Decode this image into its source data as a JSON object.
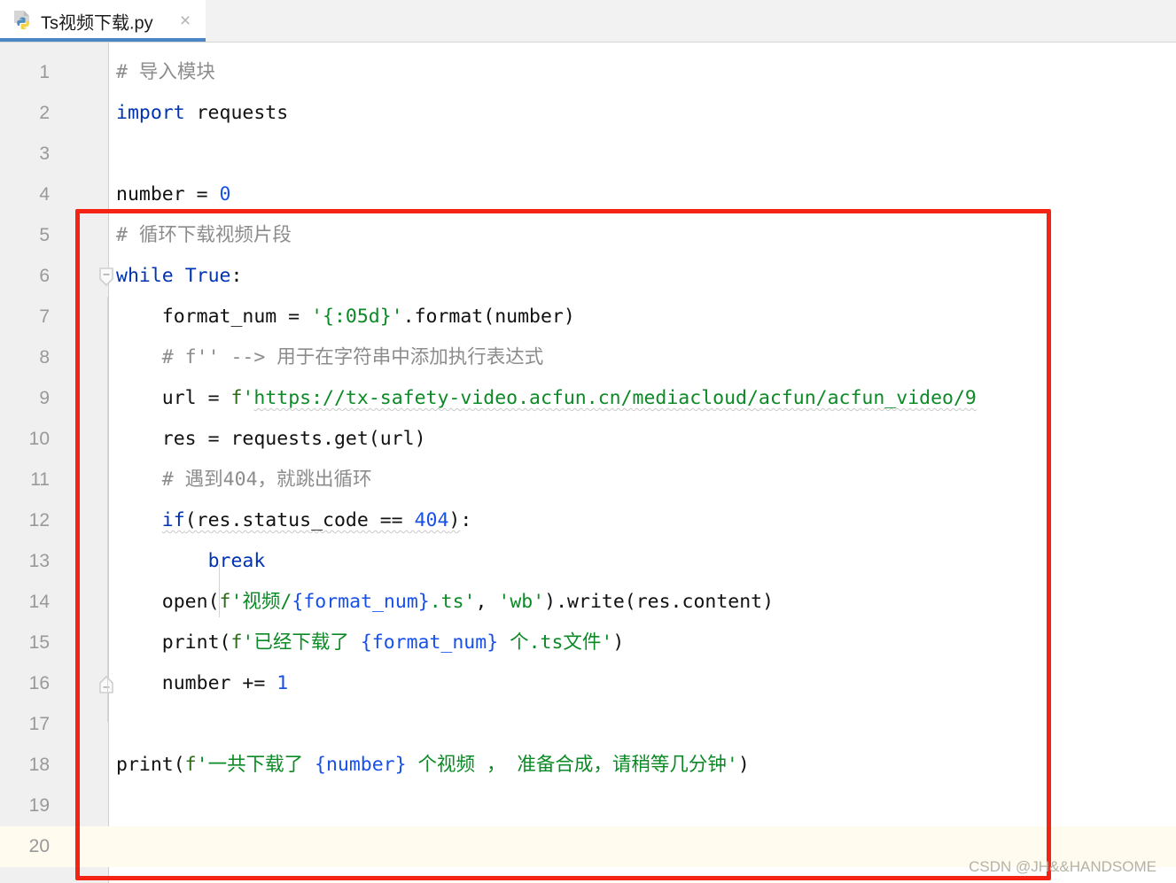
{
  "window": {
    "app_kind": "code-editor",
    "accent_color": "#4b87c6",
    "annotation_color": "#f52314"
  },
  "tab": {
    "title": "Ts视频下载.py",
    "icon": "python-file-icon",
    "close_label": "×",
    "active": true
  },
  "editor": {
    "language": "Python",
    "current_line": 20,
    "total_visible_lines": 20,
    "line_numbers": [
      "1",
      "2",
      "3",
      "4",
      "5",
      "6",
      "7",
      "8",
      "9",
      "10",
      "11",
      "12",
      "13",
      "14",
      "15",
      "16",
      "17",
      "18",
      "19",
      "20"
    ],
    "lines": [
      {
        "n": "1",
        "indent": 0,
        "tokens": [
          {
            "t": "comment",
            "s": "# 导入模块"
          }
        ]
      },
      {
        "n": "2",
        "indent": 0,
        "tokens": [
          {
            "t": "keyword",
            "s": "import"
          },
          {
            "t": "plain",
            "s": " requests"
          }
        ]
      },
      {
        "n": "3",
        "indent": 0,
        "tokens": []
      },
      {
        "n": "4",
        "indent": 0,
        "tokens": [
          {
            "t": "plain",
            "s": "number = "
          },
          {
            "t": "number",
            "s": "0"
          }
        ]
      },
      {
        "n": "5",
        "indent": 0,
        "tokens": [
          {
            "t": "comment",
            "s": "# 循环下载视频片段"
          }
        ]
      },
      {
        "n": "6",
        "indent": 0,
        "fold": "collapse-start",
        "tokens": [
          {
            "t": "keyword",
            "s": "while"
          },
          {
            "t": "plain",
            "s": " "
          },
          {
            "t": "keyword",
            "s": "True"
          },
          {
            "t": "plain",
            "s": ":"
          }
        ]
      },
      {
        "n": "7",
        "indent": 1,
        "tokens": [
          {
            "t": "plain",
            "s": "format_num = "
          },
          {
            "t": "string",
            "s": "'{:05d}'"
          },
          {
            "t": "plain",
            "s": ".format(number)"
          }
        ]
      },
      {
        "n": "8",
        "indent": 1,
        "tokens": [
          {
            "t": "comment",
            "s": "# f'' --> 用于在字符串中添加执行表达式"
          }
        ]
      },
      {
        "n": "9",
        "indent": 1,
        "tokens": [
          {
            "t": "plain",
            "s": "url = "
          },
          {
            "t": "fprefix",
            "s": "f"
          },
          {
            "t": "string",
            "s": "'"
          },
          {
            "t": "string-warn",
            "s": "https://tx-safety-video.acfun.cn/mediacloud/acfun/acfun_video/9"
          }
        ]
      },
      {
        "n": "10",
        "indent": 1,
        "tokens": [
          {
            "t": "plain",
            "s": "res = requests.get(url)"
          }
        ]
      },
      {
        "n": "11",
        "indent": 1,
        "tokens": [
          {
            "t": "comment",
            "s": "# 遇到404，就跳出循环"
          }
        ]
      },
      {
        "n": "12",
        "indent": 1,
        "tokens": [
          {
            "t": "keyword-warn",
            "s": "if"
          },
          {
            "t": "plain-warn",
            "s": "(res.status_code == "
          },
          {
            "t": "number-warn",
            "s": "404"
          },
          {
            "t": "plain-warn",
            "s": ")"
          },
          {
            "t": "plain",
            "s": ":"
          }
        ]
      },
      {
        "n": "13",
        "indent": 2,
        "tokens": [
          {
            "t": "keyword",
            "s": "break"
          }
        ]
      },
      {
        "n": "14",
        "indent": 1,
        "tokens": [
          {
            "t": "plain",
            "s": "open("
          },
          {
            "t": "fprefix",
            "s": "f"
          },
          {
            "t": "string",
            "s": "'视频/"
          },
          {
            "t": "interp",
            "s": "{format_num}"
          },
          {
            "t": "string",
            "s": ".ts'"
          },
          {
            "t": "plain",
            "s": ", "
          },
          {
            "t": "string",
            "s": "'wb'"
          },
          {
            "t": "plain",
            "s": ").write(res.content)"
          }
        ]
      },
      {
        "n": "15",
        "indent": 1,
        "tokens": [
          {
            "t": "plain",
            "s": "print("
          },
          {
            "t": "fprefix",
            "s": "f"
          },
          {
            "t": "string",
            "s": "'已经下载了 "
          },
          {
            "t": "interp",
            "s": "{format_num}"
          },
          {
            "t": "string",
            "s": " 个.ts文件'"
          },
          {
            "t": "plain",
            "s": ")"
          }
        ]
      },
      {
        "n": "16",
        "indent": 1,
        "fold": "collapse-end",
        "tokens": [
          {
            "t": "plain",
            "s": "number += "
          },
          {
            "t": "number",
            "s": "1"
          }
        ]
      },
      {
        "n": "17",
        "indent": 0,
        "tokens": []
      },
      {
        "n": "18",
        "indent": 0,
        "tokens": [
          {
            "t": "plain",
            "s": "print("
          },
          {
            "t": "fprefix",
            "s": "f"
          },
          {
            "t": "string",
            "s": "'一共下载了 "
          },
          {
            "t": "interp",
            "s": "{number}"
          },
          {
            "t": "string",
            "s": " 个视频 ， 准备合成，请稍等几分钟'"
          },
          {
            "t": "plain",
            "s": ")"
          }
        ]
      },
      {
        "n": "19",
        "indent": 0,
        "tokens": []
      },
      {
        "n": "20",
        "indent": 0,
        "current": true,
        "tokens": []
      }
    ]
  },
  "annotation": {
    "type": "red-rectangle",
    "covers_lines": "4-19"
  },
  "watermark": {
    "text": "CSDN @JH&&HANDSOME"
  }
}
